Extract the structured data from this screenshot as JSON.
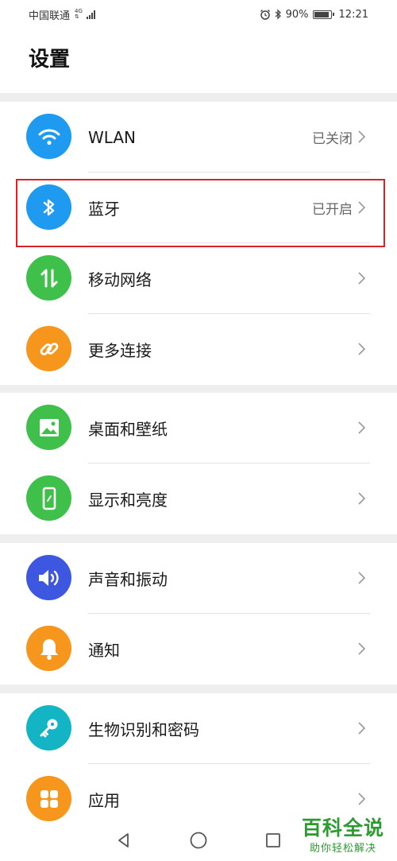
{
  "status_bar": {
    "carrier": "中国联通",
    "network_top": "4G",
    "network_bottom": "⇅",
    "battery": "90%",
    "time": "12:21"
  },
  "title": "设置",
  "items": [
    {
      "label": "WLAN",
      "value": "已关闭",
      "icon": "wifi-icon",
      "color": "#1e9bf0"
    },
    {
      "label": "蓝牙",
      "value": "已开启",
      "icon": "bluetooth-icon",
      "color": "#1e9bf0"
    },
    {
      "label": "移动网络",
      "value": "",
      "icon": "mobile-data-icon",
      "color": "#3ec04a"
    },
    {
      "label": "更多连接",
      "value": "",
      "icon": "link-icon",
      "color": "#f6961c"
    },
    {
      "label": "桌面和壁纸",
      "value": "",
      "icon": "wallpaper-icon",
      "color": "#3ec04a"
    },
    {
      "label": "显示和亮度",
      "value": "",
      "icon": "display-icon",
      "color": "#3ec04a"
    },
    {
      "label": "声音和振动",
      "value": "",
      "icon": "sound-icon",
      "color": "#3d57e0"
    },
    {
      "label": "通知",
      "value": "",
      "icon": "bell-icon",
      "color": "#f6961c"
    },
    {
      "label": "生物识别和密码",
      "value": "",
      "icon": "key-icon",
      "color": "#13b5c4"
    },
    {
      "label": "应用",
      "value": "",
      "icon": "apps-icon",
      "color": "#f6961c"
    }
  ],
  "watermark": {
    "title": "百科全说",
    "subtitle": "助你轻松解决"
  },
  "colors": {
    "highlight": "#d8232a",
    "watermark": "#2d9a32"
  }
}
